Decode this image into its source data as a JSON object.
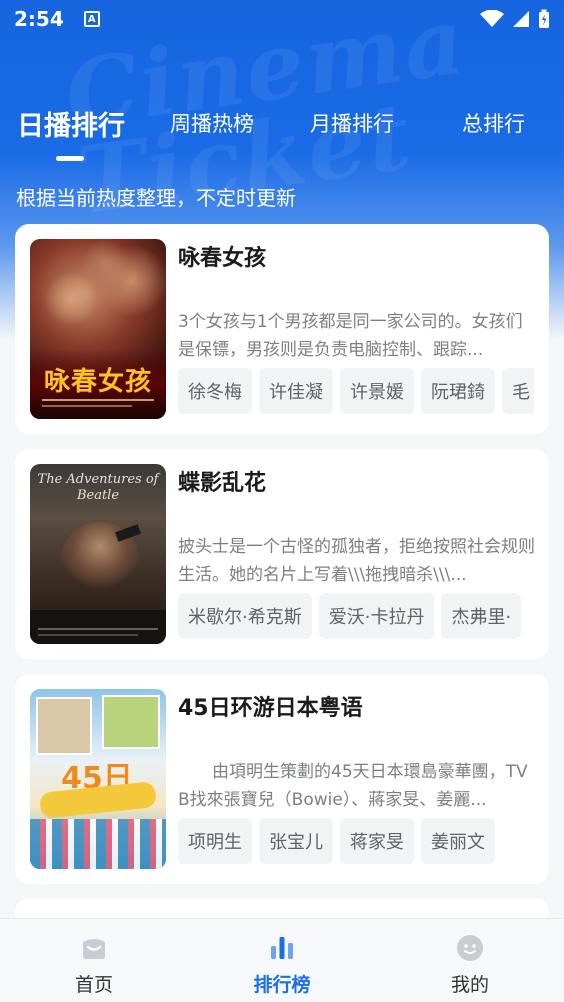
{
  "status": {
    "time": "2:54",
    "notif_letter": "A"
  },
  "watermark": "Cinema Ticket",
  "tabs": [
    {
      "label": "日播排行",
      "active": true
    },
    {
      "label": "周播热榜",
      "active": false
    },
    {
      "label": "月播排行",
      "active": false
    },
    {
      "label": "总排行",
      "active": false
    }
  ],
  "subtitle": "根据当前热度整理，不定时更新",
  "cards": [
    {
      "title": "咏春女孩",
      "desc": "3个女孩与1个男孩都是同一家公司的。女孩们是保镖，男孩则是负责电脑控制、跟踪...",
      "tags": [
        "徐冬梅",
        "许佳凝",
        "许景媛",
        "阮珺錡",
        "毛"
      ],
      "poster_text": "咏春女孩"
    },
    {
      "title": "蝶影乱花",
      "desc": "披头士是一个古怪的孤独者，拒绝按照社会规则生活。她的名片上写着\\\\\\拖拽暗杀\\\\\\...",
      "tags": [
        "米歇尔·希克斯",
        "爱沃·卡拉丹",
        "杰弗里·"
      ],
      "poster_text": "The Adventures of Beatle"
    },
    {
      "title": "45日环游日本粤语",
      "desc": "　　由項明生策劃的45天日本環島豪華團，TVB找來張寶兒（Bowie）、蔣家旻、姜麗...",
      "tags": [
        "项明生",
        "张宝儿",
        "蒋家旻",
        "姜丽文"
      ],
      "poster_text": "45日"
    }
  ],
  "nav": [
    {
      "label": "首页",
      "active": false
    },
    {
      "label": "排行榜",
      "active": true
    },
    {
      "label": "我的",
      "active": false
    }
  ],
  "colors": {
    "accent": "#1b6fe6",
    "header": "#1565e0"
  }
}
